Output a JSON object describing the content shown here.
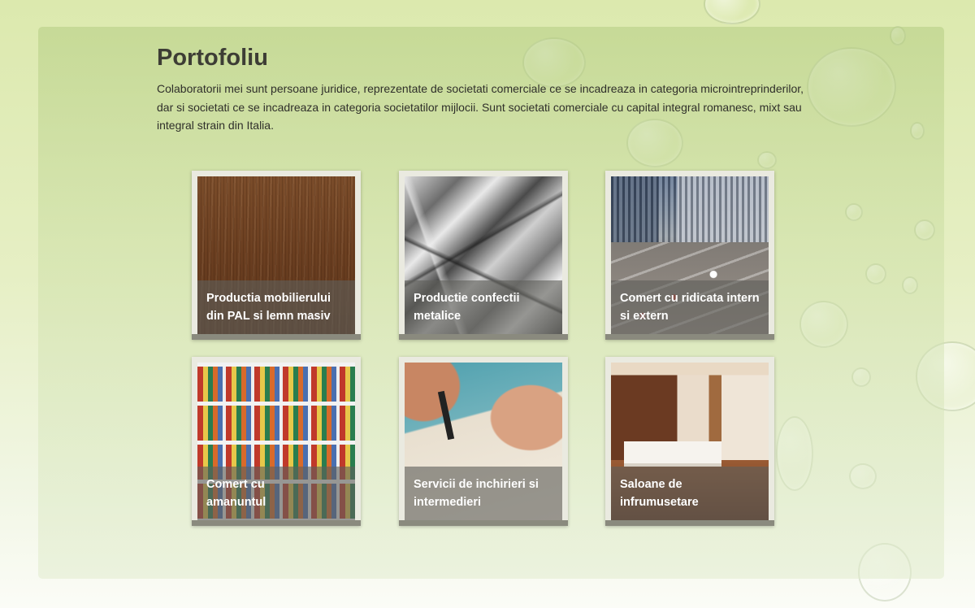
{
  "portfolio": {
    "title": "Portofoliu",
    "intro": "Colaboratorii mei sunt persoane juridice, reprezentate de societati comerciale ce se incadreaza in categoria microintreprinderilor, dar si societati ce se incadreaza in categoria societatilor mijlocii. Sunt societati comerciale cu capital integral romanesc, mixt sau integral strain din Italia.",
    "cards": [
      {
        "caption": "Productia mobilierului din PAL si lemn masiv",
        "image": "wood-texture"
      },
      {
        "caption": "Productie confectii metalice",
        "image": "metal-sheets"
      },
      {
        "caption": "Comert cu ridicata intern si extern",
        "image": "city-traffic"
      },
      {
        "caption": "Comert cu amanuntul",
        "image": "store-shelves"
      },
      {
        "caption": "Servicii de inchirieri si intermedieri",
        "image": "signing-document"
      },
      {
        "caption": "Saloane de infrumusetare",
        "image": "beauty-salon-room"
      }
    ]
  },
  "theme": {
    "accent": "#c5da8e",
    "caption_overlay": "#5f5f5a",
    "heading_color": "#3d3d35"
  }
}
